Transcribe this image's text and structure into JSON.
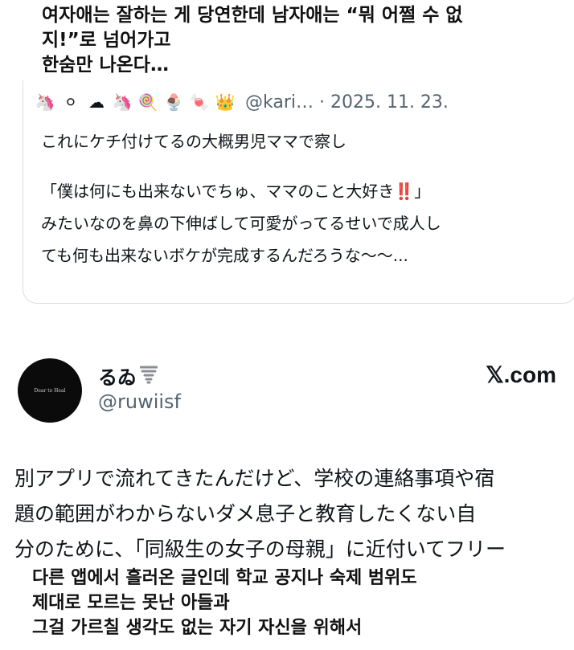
{
  "korean_caption_top": [
    "여자애는 잘하는 게 당연한데 남자애는 “뭐 어쩔 수 없",
    "지!”로 넘어가고",
    "한숨만 나온다…"
  ],
  "quoted_tweet": {
    "emojis": [
      "🦄",
      "⚪",
      "☁",
      "🦄",
      "🍭",
      "🍨",
      "🍬",
      "👑"
    ],
    "handle_and_date": "@kari… · 2025. 11. 23.",
    "lines": [
      "これにケチ付けてるの大概男児ママで察し",
      "",
      "「僕は何にも出来ないでちゅ、ママのこと大好き‼️」",
      "みたいなのを鼻の下伸ばして可愛がってるせいで成人し",
      "ても何も出来ないボケが完成するんだろうな～～..."
    ]
  },
  "tweet": {
    "avatar_text": "Dear to Heal",
    "display_name": "るゐ",
    "name_icon": "tornado-icon",
    "handle": "@ruwiisf",
    "source": "𝕏.com",
    "body_lines": [
      "別アプリで流れてきたんだけど、学校の連絡事項や宿",
      "題の範囲がわからないダメ息子と教育したくない自",
      "分のために、「同級生の女子の母親」に近付いてフリー"
    ]
  },
  "korean_caption_bottom": [
    "다른 앱에서 흘러온 글인데 학교 공지나 숙제 범위도",
    "제대로 모르는 못난 아들과",
    "그걸 가르칠 생각도 없는 자기 자신을 위해서"
  ]
}
